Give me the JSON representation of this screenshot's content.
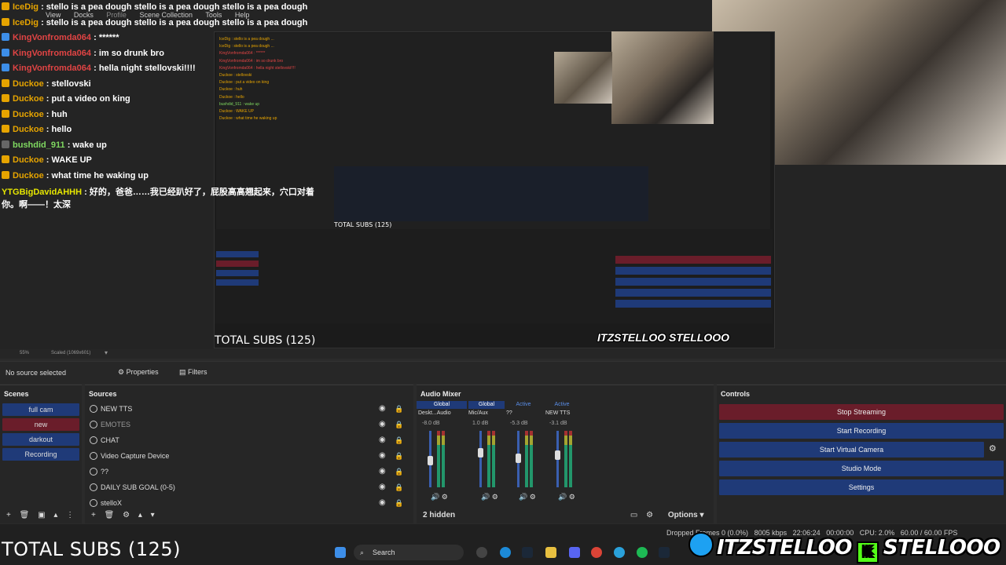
{
  "menu": {
    "items": [
      "View",
      "Docks",
      "Profile",
      "Scene Collection",
      "Tools",
      "Help"
    ]
  },
  "chat": [
    {
      "user": "IceDig",
      "user_color": "#e6a400",
      "badge": "gold",
      "msg": "stello is a pea dough stello is a pea dough stello is a pea dough"
    },
    {
      "user": "IceDig",
      "user_color": "#e6a400",
      "badge": "gold",
      "msg": "stello is a pea dough stello is a pea dough stello is a pea dough"
    },
    {
      "user": "KingVonfromda064",
      "user_color": "#e04444",
      "badge": "blue",
      "msg": "******"
    },
    {
      "user": "KingVonfromda064",
      "user_color": "#e04444",
      "badge": "blue",
      "msg": "im so drunk bro"
    },
    {
      "user": "KingVonfromda064",
      "user_color": "#e04444",
      "badge": "blue",
      "msg": "hella night stellovski!!!!"
    },
    {
      "user": "Duckoe",
      "user_color": "#e6a400",
      "badge": "gold",
      "msg": "stellovski"
    },
    {
      "user": "Duckoe",
      "user_color": "#e6a400",
      "badge": "gold",
      "msg": "put a video on king"
    },
    {
      "user": "Duckoe",
      "user_color": "#e6a400",
      "badge": "gold",
      "msg": "huh"
    },
    {
      "user": "Duckoe",
      "user_color": "#e6a400",
      "badge": "gold",
      "msg": "hello"
    },
    {
      "user": "bushdid_911",
      "user_color": "#7fd860",
      "badge": "gray",
      "msg": "wake up"
    },
    {
      "user": "Duckoe",
      "user_color": "#e6a400",
      "badge": "gold",
      "msg": "WAKE UP"
    },
    {
      "user": "Duckoe",
      "user_color": "#e6a400",
      "badge": "gold",
      "msg": "what time he waking up"
    },
    {
      "user": "YTGBigDavidAHHH",
      "user_color": "#e6e600",
      "badge": "",
      "msg": "好的，爸爸……我已经趴好了，屁股高高翘起来，穴口对着你。啊——！太深"
    }
  ],
  "preview": {
    "zoom": "55%",
    "scaled": "Scaled (1069x601)"
  },
  "source_info": {
    "no_source": "No source selected",
    "properties": "Properties",
    "filters": "Filters"
  },
  "scenes": {
    "title": "Scenes",
    "items": [
      {
        "label": "full cam",
        "active": false
      },
      {
        "label": "new",
        "active": true
      },
      {
        "label": "darkout",
        "active": false
      },
      {
        "label": "Recording",
        "active": false
      }
    ]
  },
  "sources": {
    "title": "Sources",
    "items": [
      {
        "label": "NEW TTS",
        "dim": false
      },
      {
        "label": "EMOTES",
        "dim": true
      },
      {
        "label": "CHAT",
        "dim": false
      },
      {
        "label": "Video Capture Device",
        "dim": false
      },
      {
        "label": "??",
        "dim": false
      },
      {
        "label": "DAILY SUB GOAL (0-5)",
        "dim": false
      },
      {
        "label": "stelloX",
        "dim": false
      }
    ]
  },
  "mixer": {
    "title": "Audio Mixer",
    "headers": [
      "Global",
      "Global",
      "Active",
      "Active"
    ],
    "channels": [
      {
        "name": "Deskt...Audio",
        "db": "-8.0 dB",
        "level": 0.55
      },
      {
        "name": "Mic/Aux",
        "db": "1.0 dB",
        "level": 0.7
      },
      {
        "name": "??",
        "db": "-5.3 dB",
        "level": 0.6
      },
      {
        "name": "NEW TTS",
        "db": "-3.1 dB",
        "level": 0.65
      }
    ],
    "hidden": "2 hidden",
    "options": "Options"
  },
  "controls": {
    "title": "Controls",
    "buttons": [
      "Stop Streaming",
      "Start Recording",
      "Start Virtual Camera",
      "Studio Mode",
      "Settings"
    ]
  },
  "status": {
    "dropped": "Dropped Frames 0 (0.0%)",
    "bitrate": "8005 kbps",
    "time1": "22:06:24",
    "time2": "00:00:00",
    "cpu": "CPU: 2.0%",
    "fps": "60.00 / 60.00 FPS"
  },
  "overlay": {
    "total_subs": "TOTAL SUBS (125)",
    "twitter_handle": "ITZSTELLOO",
    "kick_handle": "STELLOOO"
  },
  "taskbar": {
    "search": "Search"
  }
}
